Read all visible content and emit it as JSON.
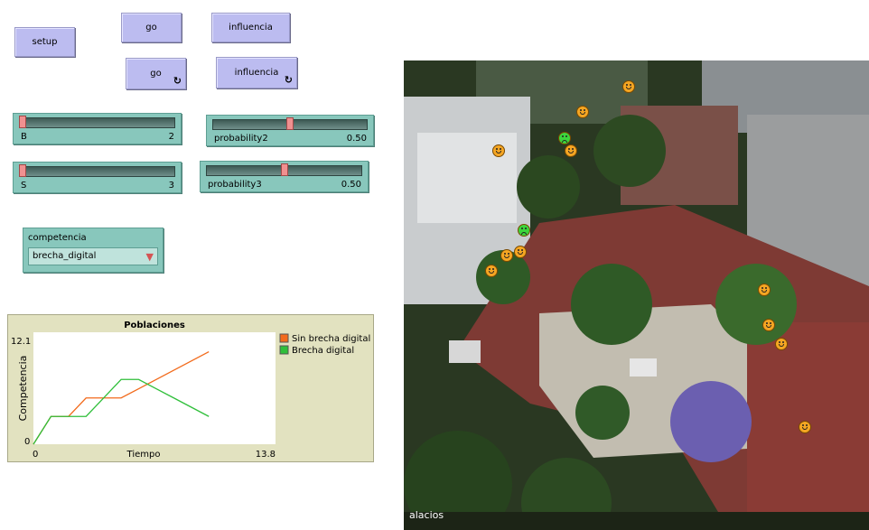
{
  "buttons": {
    "setup": "setup",
    "go": "go",
    "influencia": "influencia",
    "go_forever": "go",
    "influencia_forever": "influencia",
    "forever_glyph": "↻"
  },
  "sliders": {
    "B": {
      "label": "B",
      "value": "2",
      "fraction": 0.0
    },
    "probability2": {
      "label": "probability2",
      "value": "0.50",
      "fraction": 0.5
    },
    "S": {
      "label": "S",
      "value": "3",
      "fraction": 0.0
    },
    "probability3": {
      "label": "probability3",
      "value": "0.50",
      "fraction": 0.5
    }
  },
  "chooser": {
    "label": "competencia",
    "selected": "brecha_digital",
    "arrow": "▼"
  },
  "plot": {
    "title": "Poblaciones",
    "xlabel": "Tiempo",
    "ylabel": "Competencia",
    "xmin_label": "0",
    "xmax_label": "13.8",
    "ymin_label": "0",
    "ymax_label": "12.1"
  },
  "chart_data": {
    "type": "line",
    "title": "Poblaciones",
    "xlabel": "Tiempo",
    "ylabel": "Competencia",
    "xlim": [
      0,
      13.8
    ],
    "ylim": [
      0,
      12.1
    ],
    "legend": "right",
    "series": [
      {
        "name": "Sin brecha digital",
        "color": "#f26a1b",
        "x": [
          0,
          1,
          2,
          3,
          4,
          5,
          6,
          7,
          8,
          9,
          10
        ],
        "y": [
          0,
          3,
          3,
          5,
          5,
          5,
          6,
          7,
          8,
          9,
          10
        ]
      },
      {
        "name": "Brecha digital",
        "color": "#2fbf3a",
        "x": [
          0,
          1,
          2,
          3,
          4,
          5,
          6,
          7,
          8,
          9,
          10
        ],
        "y": [
          0,
          3,
          3,
          3,
          5,
          7,
          7,
          6,
          5,
          4,
          3
        ]
      }
    ]
  },
  "view": {
    "caption": "alacios",
    "colors": {
      "happy": "#f5a623",
      "sad": "#3cd63c"
    }
  }
}
